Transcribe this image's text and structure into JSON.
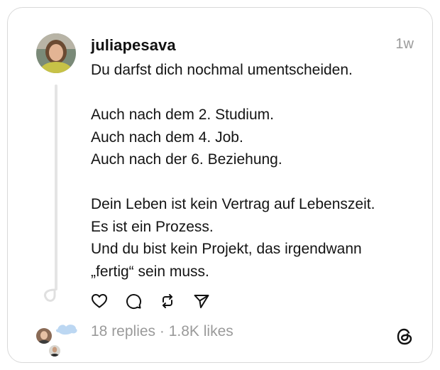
{
  "post": {
    "username": "juliapesava",
    "time": "1w",
    "lines": [
      "Du darfst dich nochmal umentscheiden.",
      "",
      "Auch nach dem 2. Studium.",
      "Auch nach dem 4. Job.",
      "Auch nach der 6. Beziehung.",
      "",
      "Dein Leben ist kein Vertrag auf Lebenszeit.",
      "Es ist ein Prozess.",
      "Und du bist kein Projekt, das irgendwann",
      "„fertig“ sein muss."
    ],
    "stats": "18 replies · 1.8K likes"
  },
  "actions": [
    "heart-icon",
    "comment-icon",
    "repost-icon",
    "share-icon"
  ],
  "colors": {
    "text": "#101010",
    "muted": "#9a9a9a",
    "border": "#d9d9d9",
    "thread_line": "#e4e4e4"
  }
}
